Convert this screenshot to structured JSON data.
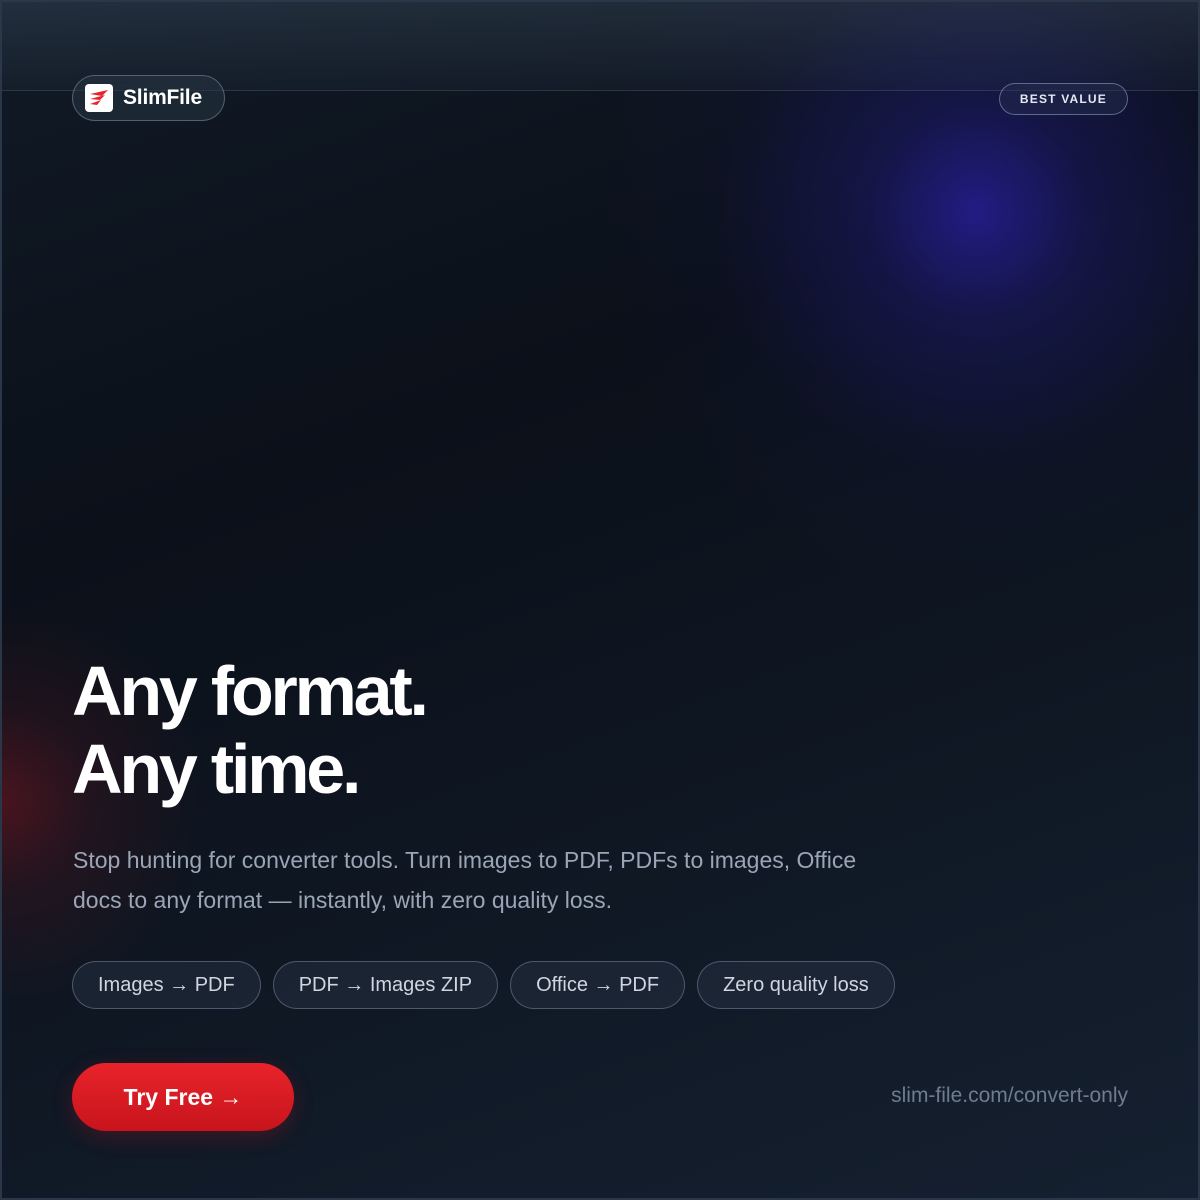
{
  "brand": {
    "name": "SlimFile",
    "logo_icon": "slimfile-logo-icon",
    "accent_color": "#e8232b"
  },
  "badge": {
    "label": "BEST VALUE"
  },
  "hero": {
    "headline_line1": "Any format.",
    "headline_line2": "Any time.",
    "subtext": "Stop hunting for converter tools. Turn images to PDF, PDFs to images, Office docs to any format — instantly, with zero quality loss."
  },
  "features": [
    {
      "label": "Images → PDF"
    },
    {
      "label": "PDF → Images ZIP"
    },
    {
      "label": "Office → PDF"
    },
    {
      "label": "Zero quality loss"
    }
  ],
  "cta": {
    "label": "Try Free →"
  },
  "footer": {
    "url": "slim-file.com/convert-only"
  }
}
